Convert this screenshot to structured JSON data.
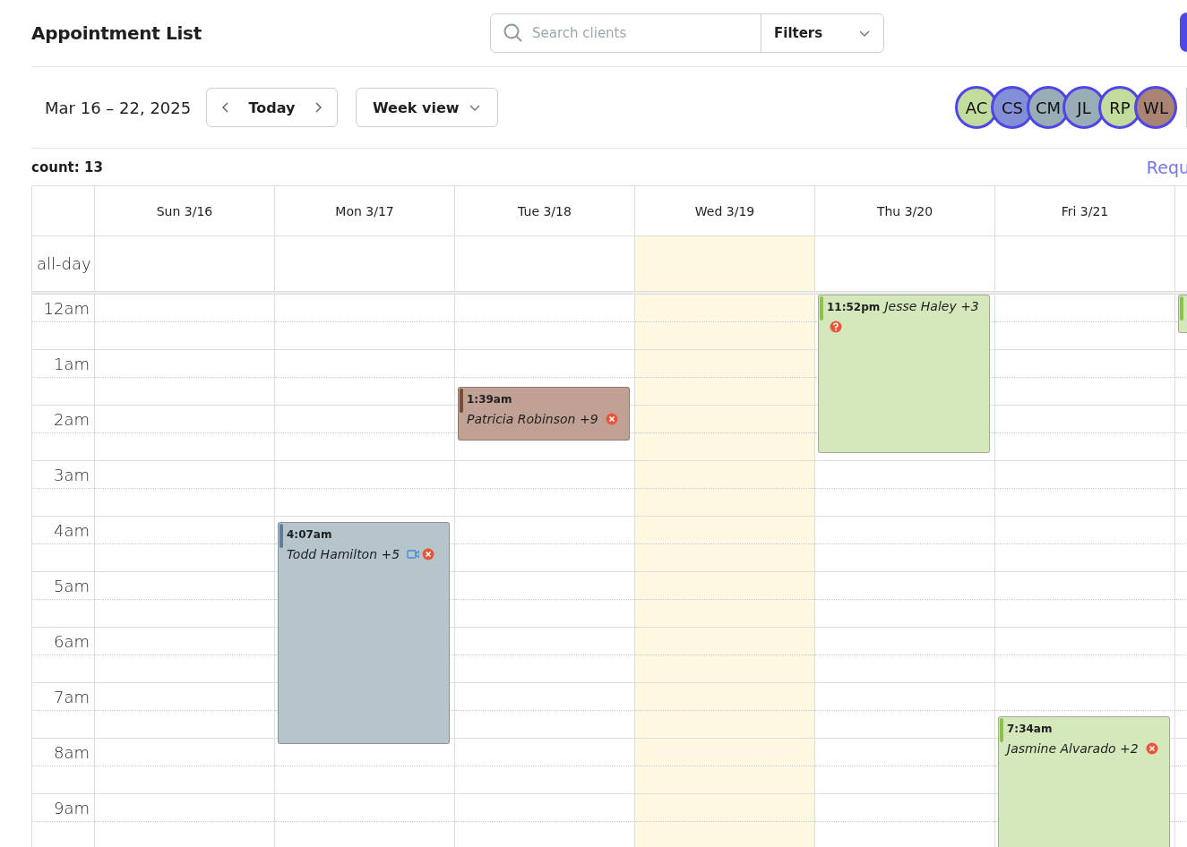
{
  "header": {
    "title": "Appointment List",
    "search": {
      "placeholder": "Search clients"
    },
    "filters": {
      "label": "Filters"
    }
  },
  "toolbar": {
    "date_range": "Mar 16 – 22, 2025",
    "today_button": "Today",
    "view_select": "Week view",
    "staff": [
      {
        "initials": "AC",
        "color": "#c2dd9b"
      },
      {
        "initials": "CS",
        "color": "#8490d6"
      },
      {
        "initials": "CM",
        "color": "#99adb6"
      },
      {
        "initials": "JL",
        "color": "#99adb6"
      },
      {
        "initials": "RP",
        "color": "#c2dd9b"
      },
      {
        "initials": "WL",
        "color": "#a98474"
      }
    ]
  },
  "count": "count: 13",
  "request_link": "Requ",
  "calendar": {
    "all_day_label": "all-day",
    "hours": [
      "12am",
      "1am",
      "2am",
      "3am",
      "4am",
      "5am",
      "6am",
      "7am",
      "8am",
      "9am"
    ],
    "days": [
      {
        "label": "Sun 3/16",
        "today": false
      },
      {
        "label": "Mon 3/17",
        "today": false,
        "events": [
          {
            "time": "4:07am",
            "client": "Todd Hamilton +5",
            "color": "#b6c5cc",
            "video": true,
            "cancelled": true,
            "unconfirmed": false
          }
        ]
      },
      {
        "label": "Tue 3/18",
        "today": false,
        "events": [
          {
            "time": "1:39am",
            "client": "Patricia Robinson +9",
            "color": "#c1a194",
            "video": false,
            "cancelled": true,
            "unconfirmed": false
          }
        ]
      },
      {
        "label": "Wed 3/19",
        "today": true
      },
      {
        "label": "Thu 3/20",
        "today": false,
        "events": [
          {
            "time": "11:52pm",
            "client": "Jesse Haley +3",
            "color": "#d5e8bb",
            "video": false,
            "cancelled": false,
            "unconfirmed": true
          }
        ]
      },
      {
        "label": "Fri 3/21",
        "today": false,
        "events": [
          {
            "time": "7:34am",
            "client": "Jasmine Alvarado +2",
            "color": "#d5e8bb",
            "video": false,
            "cancelled": true,
            "unconfirmed": false
          }
        ]
      },
      {
        "today": false,
        "events": [
          {
            "color": "#d5e8bb"
          }
        ]
      }
    ]
  }
}
